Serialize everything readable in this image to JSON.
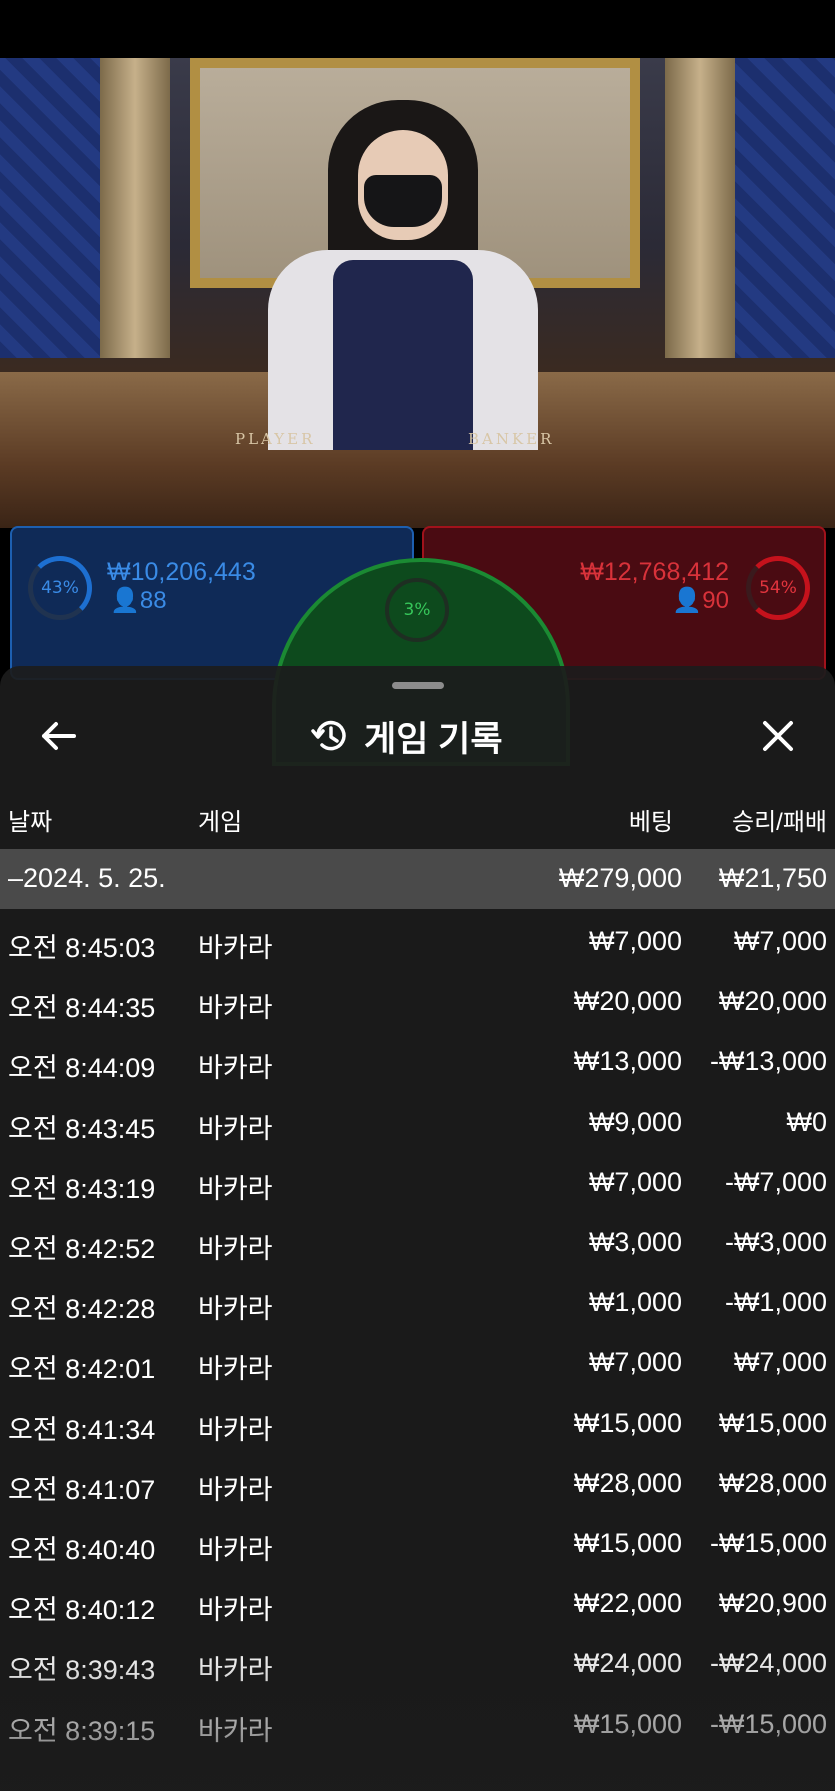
{
  "video": {
    "player_label": "PLAYER",
    "banker_label": "BANKER"
  },
  "betting_board": {
    "player": {
      "percent": "43%",
      "amount": "₩10,206,443",
      "count": "88"
    },
    "banker": {
      "percent": "54%",
      "amount": "₩12,768,412",
      "count": "90"
    },
    "tie": {
      "percent": "3%"
    }
  },
  "history": {
    "title": "게임 기록",
    "icons": {
      "back": "arrow-left-icon",
      "title": "history-clock-icon",
      "close": "close-icon"
    },
    "columns": {
      "date": "날짜",
      "game": "게임",
      "bet": "베팅",
      "result": "승리/패배"
    },
    "summary": {
      "date": "–2024. 5. 25.",
      "bet": "₩279,000",
      "result": "₩21,750"
    },
    "rows": [
      {
        "time": "오전 8:45:03",
        "game": "바카라",
        "bet": "₩7,000",
        "result": "₩7,000"
      },
      {
        "time": "오전 8:44:35",
        "game": "바카라",
        "bet": "₩20,000",
        "result": "₩20,000"
      },
      {
        "time": "오전 8:44:09",
        "game": "바카라",
        "bet": "₩13,000",
        "result": "-₩13,000"
      },
      {
        "time": "오전 8:43:45",
        "game": "바카라",
        "bet": "₩9,000",
        "result": "₩0"
      },
      {
        "time": "오전 8:43:19",
        "game": "바카라",
        "bet": "₩7,000",
        "result": "-₩7,000"
      },
      {
        "time": "오전 8:42:52",
        "game": "바카라",
        "bet": "₩3,000",
        "result": "-₩3,000"
      },
      {
        "time": "오전 8:42:28",
        "game": "바카라",
        "bet": "₩1,000",
        "result": "-₩1,000"
      },
      {
        "time": "오전 8:42:01",
        "game": "바카라",
        "bet": "₩7,000",
        "result": "₩7,000"
      },
      {
        "time": "오전 8:41:34",
        "game": "바카라",
        "bet": "₩15,000",
        "result": "₩15,000"
      },
      {
        "time": "오전 8:41:07",
        "game": "바카라",
        "bet": "₩28,000",
        "result": "₩28,000"
      },
      {
        "time": "오전 8:40:40",
        "game": "바카라",
        "bet": "₩15,000",
        "result": "-₩15,000"
      },
      {
        "time": "오전 8:40:12",
        "game": "바카라",
        "bet": "₩22,000",
        "result": "₩20,900"
      },
      {
        "time": "오전 8:39:43",
        "game": "바카라",
        "bet": "₩24,000",
        "result": "-₩24,000"
      },
      {
        "time": "오전 8:39:15",
        "game": "바카라",
        "bet": "₩15,000",
        "result": "-₩15,000"
      }
    ]
  },
  "colors": {
    "player": "#1d6fd1",
    "banker": "#c5121c",
    "tie": "#2ea94a",
    "sheet": "#1c1c1c"
  }
}
